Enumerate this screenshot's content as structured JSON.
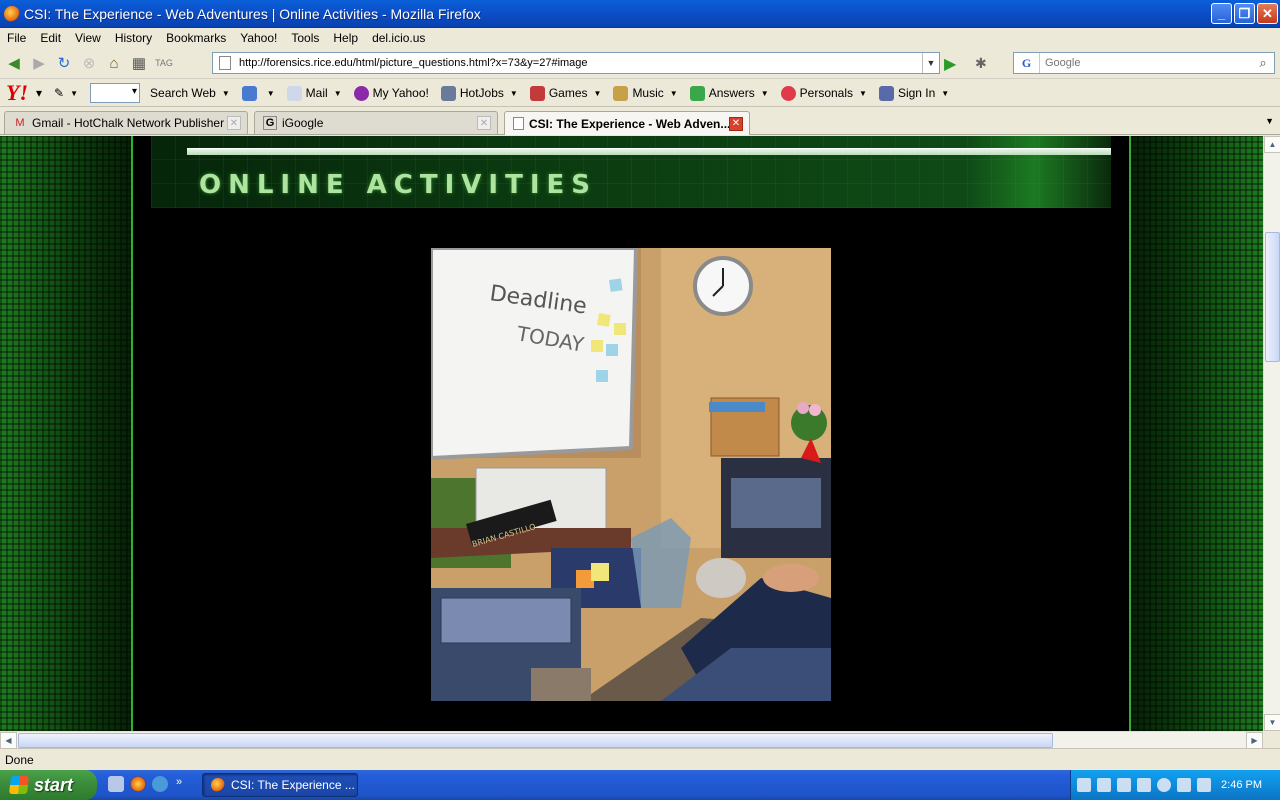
{
  "window": {
    "title": "CSI: The Experience - Web Adventures | Online Activities - Mozilla Firefox"
  },
  "menu": [
    "File",
    "Edit",
    "View",
    "History",
    "Bookmarks",
    "Yahoo!",
    "Tools",
    "Help",
    "del.icio.us"
  ],
  "nav": {
    "url": "http://forensics.rice.edu/html/picture_questions.html?x=73&y=27#image",
    "search_placeholder": "Google"
  },
  "yahoo_toolbar": {
    "logo": "Y!",
    "search_label": "Search Web",
    "items": [
      "Mail",
      "My Yahoo!",
      "HotJobs",
      "Games",
      "Music",
      "Answers",
      "Personals",
      "Sign In"
    ]
  },
  "tabs": [
    {
      "label": "Gmail - HotChalk Network Publisher Up...",
      "icon": "gmail-icon"
    },
    {
      "label": "iGoogle",
      "icon": "google-icon"
    },
    {
      "label": "CSI: The Experience - Web Adven...",
      "icon": "page-icon",
      "active": true
    }
  ],
  "page": {
    "banner_title": "ONLINE ACTIVITIES",
    "photo": {
      "whiteboard_line1": "Deadline",
      "whiteboard_line2": "TODAY",
      "nameplate": "BRIAN CASTILLO"
    }
  },
  "status": "Done",
  "taskbar": {
    "start": "start",
    "window_button": "CSI: The Experience ...",
    "clock": "2:46 PM"
  },
  "colors": {
    "accent": "#2fb12f",
    "banner_text": "#aee3a0",
    "xp_blue": "#245edb"
  }
}
